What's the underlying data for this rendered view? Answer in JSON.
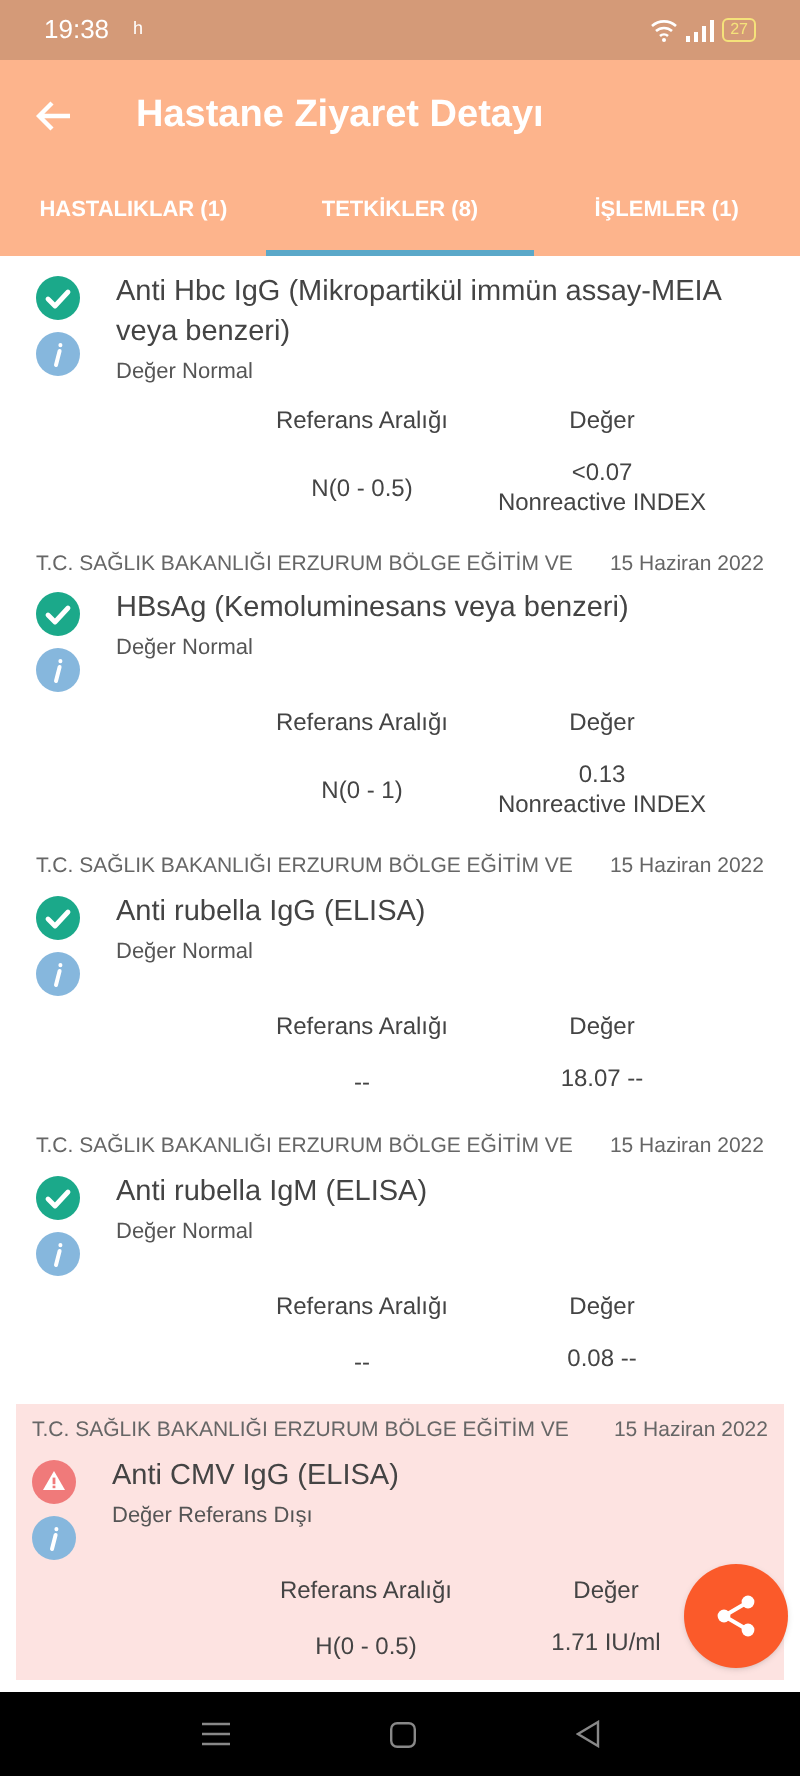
{
  "status_bar": {
    "time": "19:38",
    "notification": "h",
    "battery": "27"
  },
  "app_bar": {
    "title": "Hastane Ziyaret Detayı"
  },
  "tabs": [
    {
      "label": "HASTALIKLAR (1)",
      "selected": false
    },
    {
      "label": "TETKİKLER (8)",
      "selected": true
    },
    {
      "label": "İŞLEMLER (1)",
      "selected": false
    }
  ],
  "results": [
    {
      "kind": "normal",
      "name": "Anti Hbc IgG (Mikropartikül immün assay-MEIA veya benzeri)",
      "status_text": "Değer Normal",
      "ref_header": "Referans Aralığı",
      "value_header": "Değer",
      "ref": "N(0 - 0.5)",
      "value_lines": [
        "<0.07",
        "Nonreactive INDEX"
      ]
    },
    {
      "kind": "normal",
      "source": "T.C. SAĞLIK BAKANLIĞI ERZURUM BÖLGE EĞİTİM VE",
      "date": "15 Haziran 2022",
      "name": "HBsAg (Kemoluminesans veya benzeri)",
      "status_text": "Değer Normal",
      "ref_header": "Referans Aralığı",
      "value_header": "Değer",
      "ref": "N(0 - 1)",
      "value_lines": [
        "0.13",
        "Nonreactive INDEX"
      ]
    },
    {
      "kind": "normal",
      "source": "T.C. SAĞLIK BAKANLIĞI ERZURUM BÖLGE EĞİTİM VE",
      "date": "15 Haziran 2022",
      "name": "Anti rubella IgG (ELISA)",
      "status_text": "Değer Normal",
      "ref_header": "Referans Aralığı",
      "value_header": "Değer",
      "ref": "--",
      "value_lines": [
        "18.07 --"
      ]
    },
    {
      "kind": "normal",
      "source": "T.C. SAĞLIK BAKANLIĞI ERZURUM BÖLGE EĞİTİM VE",
      "date": "15 Haziran 2022",
      "name": "Anti rubella IgM (ELISA)",
      "status_text": "Değer Normal",
      "ref_header": "Referans Aralığı",
      "value_header": "Değer",
      "ref": "--",
      "value_lines": [
        "0.08 --"
      ]
    },
    {
      "kind": "abnormal",
      "source": "T.C. SAĞLIK BAKANLIĞI ERZURUM BÖLGE EĞİTİM VE",
      "date": "15 Haziran 2022",
      "name": "Anti CMV IgG (ELISA)",
      "status_text": "Değer Referans Dışı",
      "ref_header": "Referans Aralığı",
      "value_header": "Değer",
      "ref": "H(0 - 0.5)",
      "value_lines": [
        "1.71 IU/ml"
      ]
    }
  ]
}
